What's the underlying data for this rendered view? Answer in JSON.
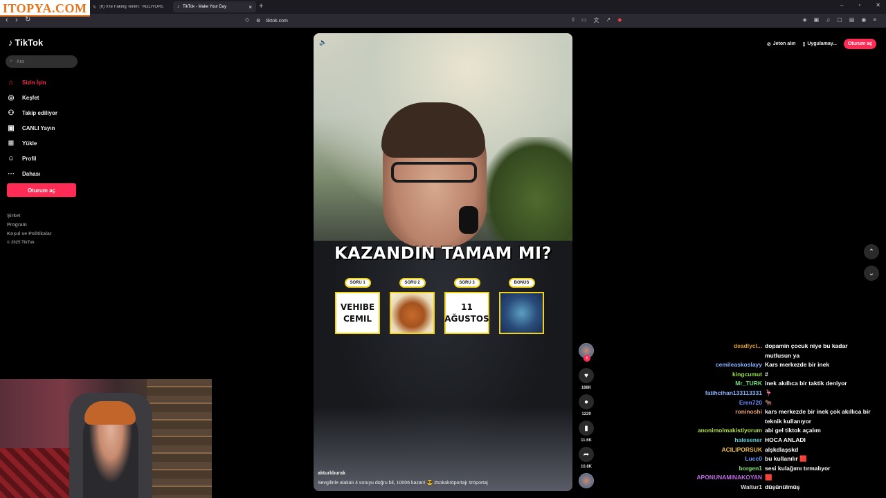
{
  "watermark": "ITOPYA.COM",
  "tabs": [
    {
      "label": "(6) X'te Faking Tenim: \"AĞLIYORUM &...",
      "icon": "x-icon"
    },
    {
      "label": "TikTok - Make Your Day",
      "icon": "tiktok-icon"
    }
  ],
  "address": {
    "url": "tiktok.com"
  },
  "sidebar": {
    "brand": "TikTok",
    "search_placeholder": "Ara",
    "items": [
      {
        "label": "Sizin İçin",
        "icon": "home-icon",
        "active": true
      },
      {
        "label": "Keşfet",
        "icon": "compass-icon"
      },
      {
        "label": "Takip ediliyor",
        "icon": "following-icon"
      },
      {
        "label": "CANLI Yayın",
        "icon": "live-icon"
      },
      {
        "label": "Yükle",
        "icon": "upload-icon"
      },
      {
        "label": "Profil",
        "icon": "profile-icon"
      },
      {
        "label": "Dahası",
        "icon": "more-icon"
      }
    ],
    "login": "Oturum aç",
    "footer": [
      "Şirket",
      "Program",
      "Koşul ve Politikalar"
    ],
    "copyright": "© 2025 TikTok"
  },
  "topbar": {
    "coins": "Jeton alın",
    "app": "Uygulamay...",
    "login": "Oturum aç"
  },
  "video": {
    "headline": "KAZANDIN TAMAM MI?",
    "questions": [
      {
        "label": "SORU 1",
        "answer_line1": "VEHIBE",
        "answer_line2": "CEMIL"
      },
      {
        "label": "SORU 2",
        "answer_line1": "",
        "answer_line2": ""
      },
      {
        "label": "SORU 3",
        "answer_line1": "11",
        "answer_line2": "AĞUSTOS"
      },
      {
        "label": "BONUS",
        "answer_line1": "",
        "answer_line2": ""
      }
    ],
    "author": "akturkburak",
    "caption": "Sevgilinle alakalı 4 soruyu doğru bil, 10006 kazan! 😎 #sokakröportajı #röportaj"
  },
  "actions": {
    "likes": "188K",
    "comments": "1229",
    "saves": "11.6K",
    "shares": "10.8K"
  },
  "chat": [
    {
      "user": "deadlycl...",
      "color": "#e09a2c",
      "text": "dopamin çocuk niye bu kadar mutlusun ya"
    },
    {
      "user": "cemileaskoslayy",
      "color": "#8ab4ff",
      "text": "Kars merkezde bir inek"
    },
    {
      "user": "kingcumut",
      "color": "#9be24a",
      "text": "#"
    },
    {
      "user": "Mr_TURK",
      "color": "#6ee07a",
      "text": "inek akıllıca bir taktik deniyor"
    },
    {
      "user": "fatihcihan133113331",
      "color": "#8ab4ff",
      "text": "🦩"
    },
    {
      "user": "Eren720",
      "color": "#6a8cff",
      "text": "🐂"
    },
    {
      "user": "roninoshi",
      "color": "#e8a070",
      "text": "kars merkezde bir inek çok akıllıca bir teknik kullanıyor"
    },
    {
      "user": "anonimolmakistiyorum",
      "color": "#b8e04a",
      "text": "abi gel tiktok açalım"
    },
    {
      "user": "halesener",
      "color": "#5ad0d8",
      "text": "HOCA ANLADI"
    },
    {
      "user": "ACILIPORSUK",
      "color": "#f0c040",
      "text": "alşkdlaşskd"
    },
    {
      "user": "Lucc0",
      "color": "#6a9cff",
      "text": "bu kullanılır 🟥"
    },
    {
      "user": "borgen1",
      "color": "#8ae07a",
      "text": "sesi kulağımı tırmalıyor"
    },
    {
      "user": "APONUNAMINAKOYAN",
      "color": "#c26ae8",
      "text": "🟥"
    },
    {
      "user": "Waltur1",
      "color": "#d8d8d8",
      "text": "düşünülmüş"
    }
  ]
}
